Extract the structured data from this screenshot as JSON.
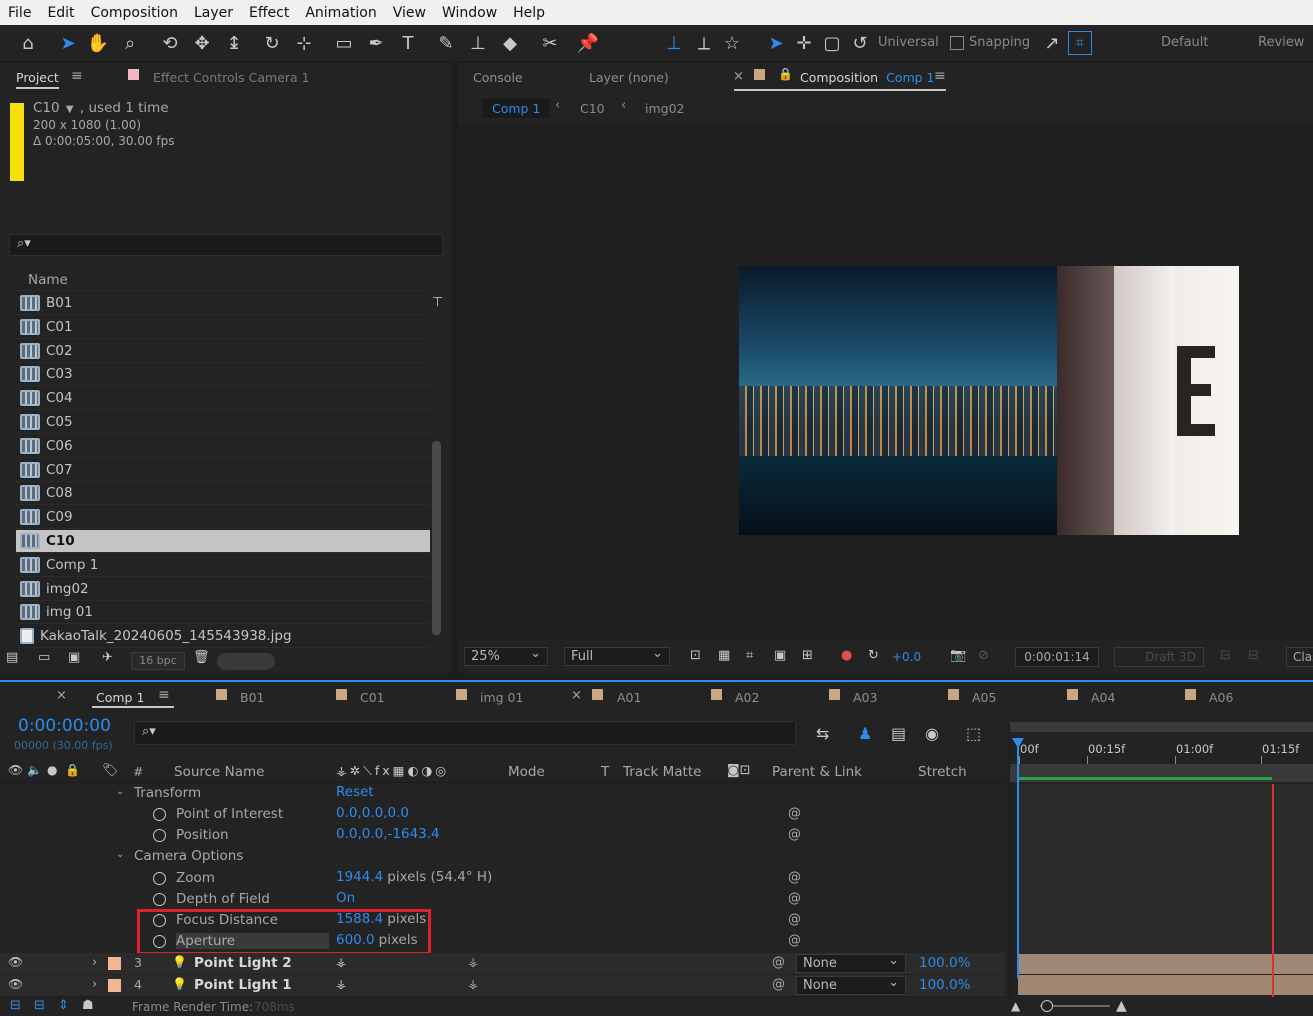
{
  "menu": [
    "File",
    "Edit",
    "Composition",
    "Layer",
    "Effect",
    "Animation",
    "View",
    "Window",
    "Help"
  ],
  "toolbar": {
    "universal_label": "Universal",
    "snapping_label": "Snapping",
    "workspace_default": "Default",
    "workspace_review": "Review"
  },
  "project_panel": {
    "tab_project": "Project",
    "tab_effect_controls": "Effect Controls",
    "effect_controls_target": "Camera 1",
    "selected_name": "C10",
    "selected_usage": ", used 1 time",
    "selected_dims": "200 x 1080 (1.00)",
    "selected_duration": "Δ 0:00:05:00, 30.00 fps",
    "name_header": "Name",
    "items": [
      {
        "label": "B01",
        "kind": "comp"
      },
      {
        "label": "C01",
        "kind": "comp"
      },
      {
        "label": "C02",
        "kind": "comp"
      },
      {
        "label": "C03",
        "kind": "comp"
      },
      {
        "label": "C04",
        "kind": "comp"
      },
      {
        "label": "C05",
        "kind": "comp"
      },
      {
        "label": "C06",
        "kind": "comp"
      },
      {
        "label": "C07",
        "kind": "comp"
      },
      {
        "label": "C08",
        "kind": "comp"
      },
      {
        "label": "C09",
        "kind": "comp"
      },
      {
        "label": "C10",
        "kind": "comp",
        "selected": true
      },
      {
        "label": "Comp 1",
        "kind": "comp"
      },
      {
        "label": "img02",
        "kind": "comp"
      },
      {
        "label": "img 01",
        "kind": "comp"
      },
      {
        "label": "KakaoTalk_20240605_145543938.jpg",
        "kind": "image"
      }
    ],
    "bpc": "16 bpc"
  },
  "viewer": {
    "tab_console": "Console",
    "tab_layer": "Layer (none)",
    "tab_composition": "Composition",
    "tab_composition_name": "Comp 1",
    "breadcrumbs": [
      "Comp 1",
      "C10",
      "img02"
    ],
    "magnification": "25%",
    "resolution": "Full",
    "exposure": "+0.0",
    "timecode": "0:00:01:14",
    "draft3d": "Draft 3D",
    "renderer": "Clas"
  },
  "timeline": {
    "tabs": [
      "Comp 1",
      "B01",
      "C01",
      "img 01",
      "A01",
      "A02",
      "A03",
      "A05",
      "A04",
      "A06"
    ],
    "timecode": "0:00:00:00",
    "frame_info": "00000 (30.00 fps)",
    "ruler": [
      "00f",
      "00:15f",
      "01:00f",
      "01:15f"
    ],
    "columns": {
      "hash": "#",
      "source_name": "Source Name",
      "mode": "Mode",
      "t": "T",
      "track_matte": "Track Matte",
      "parent_link": "Parent & Link",
      "stretch": "Stretch"
    },
    "groups": {
      "transform": "Transform",
      "transform_reset": "Reset",
      "camera_options": "Camera Options"
    },
    "properties": [
      {
        "name": "Point of Interest",
        "value": "0.0,0.0,0.0",
        "unit": ""
      },
      {
        "name": "Position",
        "value": "0.0,0.0,-1643.4",
        "unit": ""
      },
      {
        "name": "Zoom",
        "value": "1944.4",
        "unit": "pixels (54.4° H)"
      },
      {
        "name": "Depth of Field",
        "value": "On",
        "unit": ""
      },
      {
        "name": "Focus Distance",
        "value": "1588.4",
        "unit": "pixels"
      },
      {
        "name": "Aperture",
        "value": "600.0",
        "unit": "pixels"
      }
    ],
    "layers": [
      {
        "num": "3",
        "name": "Point Light 2",
        "parent": "None",
        "stretch": "100.0%"
      },
      {
        "num": "4",
        "name": "Point Light 1",
        "parent": "None",
        "stretch": "100.0%"
      }
    ],
    "frame_render_time_label": "Frame Render Time:",
    "frame_render_time_value": "708ms"
  },
  "colors": {
    "accent": "#2d8ceb",
    "highlight_box": "#e0202a",
    "label_yellow": "#f5e00c",
    "label_pink": "#f2b6c2",
    "label_tan": "#c8a882",
    "work_area_green": "#2ea043",
    "playhead_red": "#e0302a"
  }
}
